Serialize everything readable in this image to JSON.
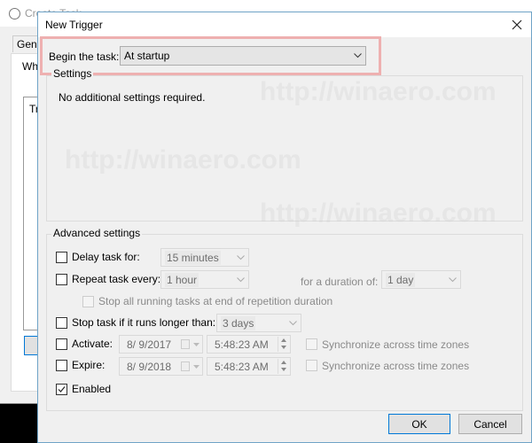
{
  "parent_window": {
    "title": "Create Task",
    "tab_partial": "Gene",
    "label_partial": "Wh",
    "list_partial": "Tr"
  },
  "dialog": {
    "title": "New Trigger",
    "close_icon": "close-icon",
    "begin_task": {
      "label": "Begin the task:",
      "value": "At startup"
    },
    "settings": {
      "group_label": "Settings",
      "message": "No additional settings required."
    },
    "advanced": {
      "group_label": "Advanced settings",
      "delay": {
        "label": "Delay task for:",
        "checked": false,
        "value": "15 minutes"
      },
      "repeat": {
        "label": "Repeat task every:",
        "checked": false,
        "value": "1 hour",
        "duration_label": "for a duration of:",
        "duration_value": "1 day"
      },
      "stop_all": {
        "label": "Stop all running tasks at end of repetition duration",
        "checked": false
      },
      "stop_longer": {
        "label": "Stop task if it runs longer than:",
        "checked": false,
        "value": "3 days"
      },
      "activate": {
        "label": "Activate:",
        "checked": false,
        "date": "8/ 9/2017",
        "time": "5:48:23 AM",
        "sync_label": "Synchronize across time zones",
        "sync_checked": false
      },
      "expire": {
        "label": "Expire:",
        "checked": false,
        "date": "8/ 9/2018",
        "time": "5:48:23 AM",
        "sync_label": "Synchronize across time zones",
        "sync_checked": false
      },
      "enabled": {
        "label": "Enabled",
        "checked": true
      }
    },
    "buttons": {
      "ok": "OK",
      "cancel": "Cancel"
    }
  },
  "watermark": "http://winaero.com"
}
